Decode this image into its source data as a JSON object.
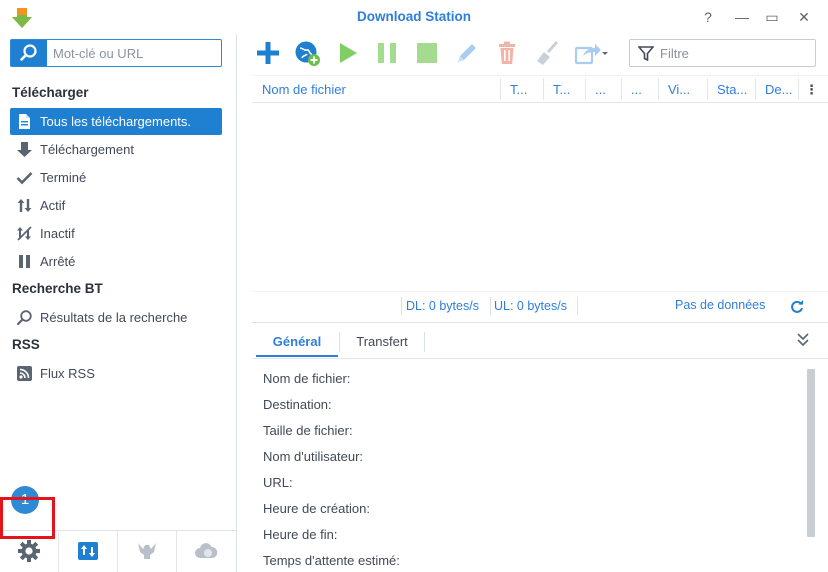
{
  "window": {
    "title": "Download Station",
    "help_label": "?",
    "minimize_label": "—",
    "maximize_label": "▭",
    "close_label": "✕"
  },
  "search": {
    "placeholder": "Mot-clé ou URL"
  },
  "sidebar": {
    "sections": [
      {
        "label": "Télécharger"
      },
      {
        "label": "Recherche BT"
      },
      {
        "label": "RSS"
      }
    ],
    "items": [
      {
        "label": "Tous les téléchargements.",
        "icon": "document-icon",
        "active": true
      },
      {
        "label": "Téléchargement",
        "icon": "arrow-down-icon"
      },
      {
        "label": "Terminé",
        "icon": "check-icon"
      },
      {
        "label": "Actif",
        "icon": "arrows-updown-icon"
      },
      {
        "label": "Inactif",
        "icon": "inactive-icon"
      },
      {
        "label": "Arrêté",
        "icon": "pause-icon"
      },
      {
        "label": "Résultats de la recherche",
        "icon": "search-icon"
      },
      {
        "label": "Flux RSS",
        "icon": "rss-icon"
      }
    ],
    "badge": "1",
    "bottom_buttons": [
      "gear-icon",
      "transfer-icon",
      "emule-icon",
      "cloud-icon"
    ]
  },
  "toolbar": {
    "buttons": [
      "add-icon",
      "add-url-icon",
      "resume-icon",
      "pause-icon",
      "stop-icon",
      "edit-icon",
      "delete-icon",
      "clear-icon",
      "share-icon"
    ],
    "filter_placeholder": "Filtre"
  },
  "grid": {
    "columns": [
      "Nom de fichier",
      "T...",
      "T...",
      "...",
      "...",
      "Vi...",
      "Sta...",
      "De..."
    ],
    "menu_label": "⋮"
  },
  "status": {
    "dl": "DL: 0 bytes/s",
    "ul": "UL: 0 bytes/s",
    "empty": "Pas de données"
  },
  "detail": {
    "tabs": [
      "Général",
      "Transfert"
    ],
    "fields": [
      "Nom de fichier:",
      "Destination:",
      "Taille de fichier:",
      "Nom d'utilisateur:",
      "URL:",
      "Heure de création:",
      "Heure de fin:",
      "Temps d'attente estimé:"
    ]
  },
  "colors": {
    "accent": "#1f7fd1",
    "link": "#2f7ed8",
    "play": "#6cc04a",
    "highlight": "#e4141b"
  }
}
